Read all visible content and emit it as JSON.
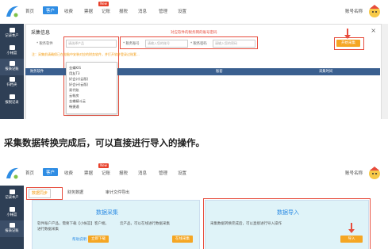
{
  "nav": {
    "items": [
      "首页",
      "客户",
      "收费",
      "票据",
      "记账",
      "报税",
      "消息",
      "管理",
      "设置"
    ],
    "active_index": 1,
    "hot_badge": "New"
  },
  "user": {
    "label": "账号名称"
  },
  "sidebar": {
    "items": [
      "记录本户",
      "小帐篮",
      "报表记账",
      "归档夹",
      "报税记录"
    ]
  },
  "dialog": {
    "title": "采集信息",
    "close": "×",
    "product_label": "* 税务软件",
    "product_placeholder": "请选择产品",
    "account_label": "* 税务账号",
    "account_placeholder": "请输入您的账号",
    "password_label": "* 税务密码",
    "password_placeholder": "请输入您的密码",
    "red_note": "对应软件的税务网的账号密码",
    "start_button": "开始采集",
    "tip": "注：采集前请确保已在电脑中安装对应的财务软件，并打开软件登录过账套...",
    "table_headers": [
      "财务软件",
      "账套",
      "采集时间"
    ],
    "dropdown": [
      "金蝶KIS",
      "用友T3",
      "好会计(云版)",
      "好会计(云版)",
      "易代账",
      "云帐房",
      "金蝶精斗云",
      "畅捷通",
      "快账云"
    ]
  },
  "caption": "采集数据转换完成后，可以直接进行导入的操作。",
  "shot2": {
    "tabs": [
      "数据同步",
      "财务数据",
      "审计文件导出"
    ],
    "active_tab": 0,
    "collect_panel": {
      "title": "数据采集",
      "text1": "软件账户产品，需要下载【小帐篮】客户端，进行数据采集",
      "text2": "云产品，可以在线进行数据采集",
      "link": "帮助说明",
      "btn1": "立即下载",
      "btn2": "在线采集"
    },
    "import_panel": {
      "title": "数据导入",
      "text": "采集数据转换完成后，可以直接进行导入操作",
      "btn": "导入"
    }
  },
  "colors": {
    "accent": "#2f8de4",
    "sidebar": "#2e3f55",
    "orange": "#f5a623",
    "red": "#e74c3c",
    "table_head": "#3a5f8f"
  }
}
